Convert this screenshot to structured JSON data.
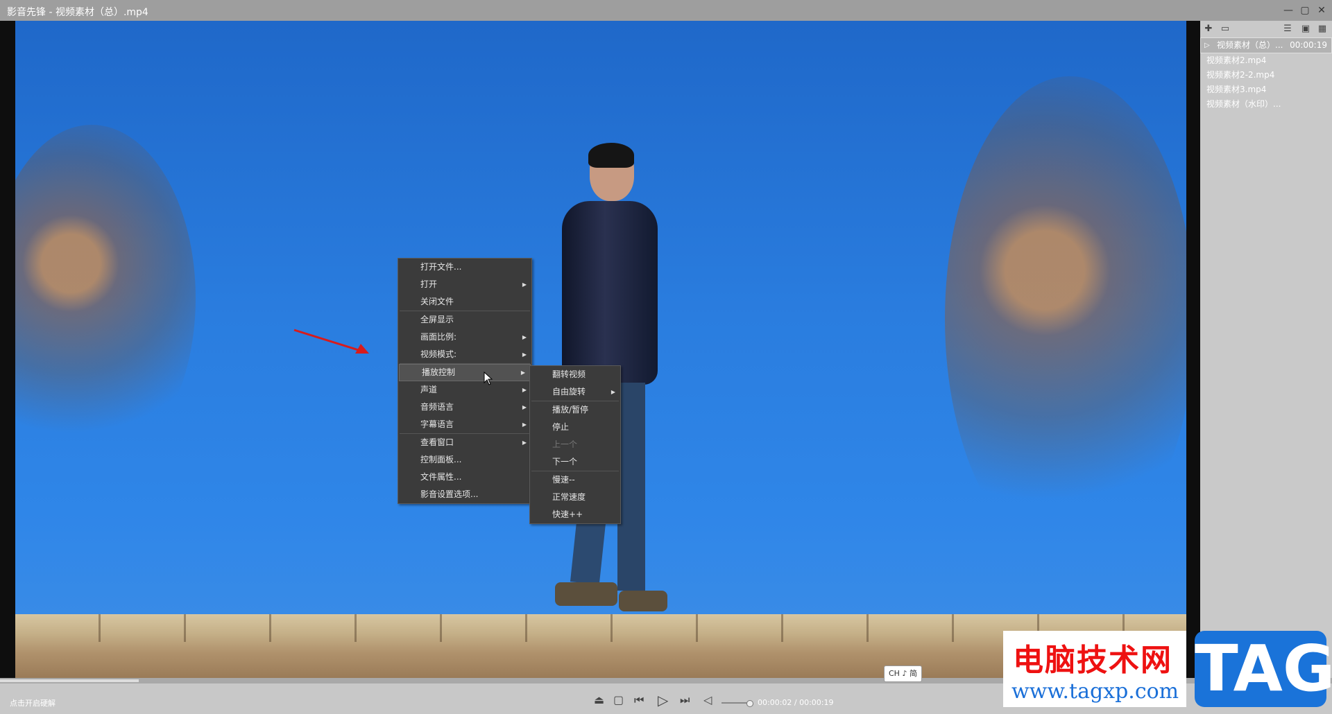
{
  "window": {
    "title": "影音先锋 - 视频素材（总）.mp4",
    "minimize_icon": "minimize-icon",
    "maximize_icon": "maximize-icon",
    "close_icon": "close-icon"
  },
  "context_menu": {
    "items": [
      {
        "label": "打开文件...",
        "submenu": false
      },
      {
        "label": "打开",
        "submenu": true
      },
      {
        "label": "关闭文件",
        "submenu": false
      },
      {
        "label": "全屏显示",
        "submenu": false
      },
      {
        "label": "画面比例:",
        "submenu": true
      },
      {
        "label": "视频模式:",
        "submenu": true
      },
      {
        "label": "播放控制",
        "submenu": true
      },
      {
        "label": "声道",
        "submenu": true
      },
      {
        "label": "音频语言",
        "submenu": true
      },
      {
        "label": "字幕语言",
        "submenu": true
      },
      {
        "label": "查看窗口",
        "submenu": true
      },
      {
        "label": "控制面板...",
        "submenu": false
      },
      {
        "label": "文件属性...",
        "submenu": false
      },
      {
        "label": "影音设置选项...",
        "submenu": false
      }
    ]
  },
  "submenu": {
    "items": [
      {
        "label": "翻转视频"
      },
      {
        "label": "自由旋转"
      },
      {
        "label": "播放/暂停"
      },
      {
        "label": "停止"
      },
      {
        "label": "上一个"
      },
      {
        "label": "下一个"
      },
      {
        "label": "慢速--"
      },
      {
        "label": "正常速度"
      },
      {
        "label": "快速++"
      }
    ]
  },
  "playlist": {
    "items": [
      {
        "name": "视频素材（总）...",
        "duration": "00:00:19"
      },
      {
        "name": "视频素材2.mp4"
      },
      {
        "name": "视频素材2-2.mp4"
      },
      {
        "name": "视频素材3.mp4"
      },
      {
        "name": "视频素材（水印）..."
      }
    ]
  },
  "status": {
    "hint": "点击开启硬解",
    "time": "00:00:02 / 00:00:19"
  },
  "ime": "CH ♪ 简",
  "watermark": {
    "site_name": "电脑技术网",
    "url": "www.tagxp.com",
    "tag": "TAG"
  }
}
